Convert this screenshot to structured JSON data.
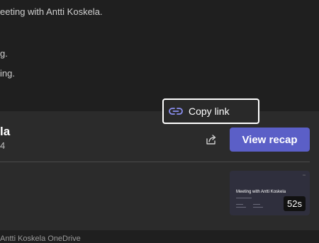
{
  "chat": {
    "messages": [
      "eeting with Antti Koskela.",
      "g.",
      "ing."
    ]
  },
  "recap_card": {
    "title": "la",
    "subtitle": "4",
    "view_button": "View recap",
    "share_icon": "share-icon",
    "thumbnail": {
      "title": "Meeting with Antti Koskela",
      "duration": "52s"
    }
  },
  "context_menu": {
    "items": [
      {
        "label": "Copy link",
        "icon": "link-icon"
      }
    ]
  },
  "footer_text": "Antti Koskela OneDrive",
  "colors": {
    "background": "#1f1f1f",
    "card": "#2b2b2b",
    "accent": "#5b5fc7"
  }
}
